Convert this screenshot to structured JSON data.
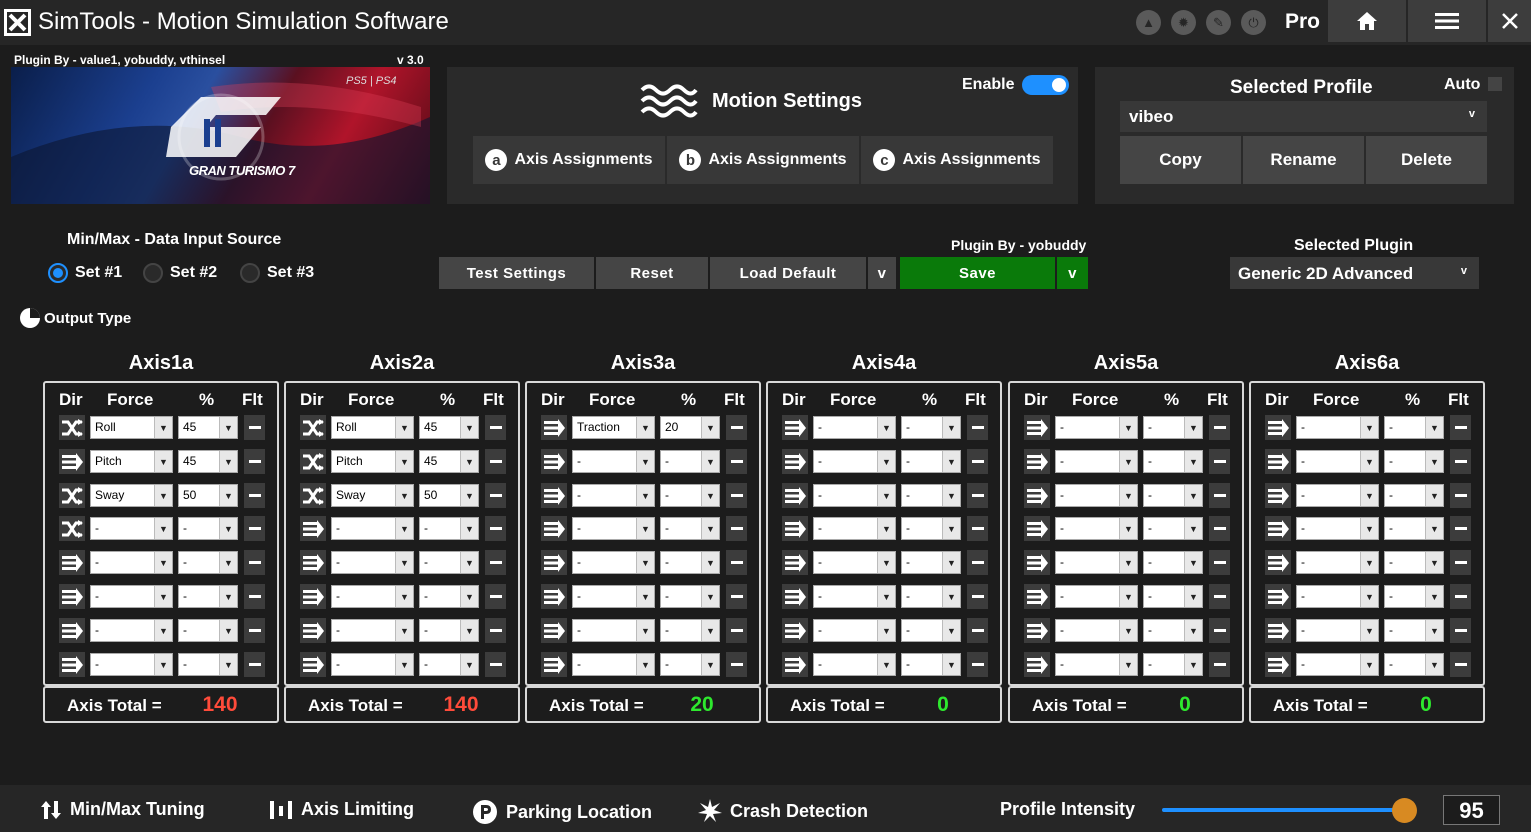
{
  "app": {
    "title": "SimTools - Motion Simulation Software",
    "edition": "Pro",
    "toolbar_icons": [
      "upload-icon",
      "gear-badge-icon",
      "edit-icon",
      "power-icon"
    ],
    "window_buttons": [
      "home-icon",
      "menu-icon",
      "close-icon"
    ]
  },
  "plugin_banner": {
    "plugin_by": "Plugin By - value1, yobuddy, vthinsel",
    "version": "v 3.0",
    "game_name": "GRAN TURISMO 7",
    "platform": "PS5 | PS4"
  },
  "motion_settings": {
    "title": "Motion Settings",
    "enable_label": "Enable",
    "enabled": true,
    "tabs": [
      {
        "letter": "a",
        "label": "Axis Assignments"
      },
      {
        "letter": "b",
        "label": "Axis Assignments"
      },
      {
        "letter": "c",
        "label": "Axis Assignments"
      }
    ]
  },
  "profile": {
    "title": "Selected Profile",
    "auto_label": "Auto",
    "auto_checked": false,
    "selected": "vibeo",
    "copy_label": "Copy",
    "rename_label": "Rename",
    "delete_label": "Delete"
  },
  "data_source": {
    "label": "Min/Max - Data Input Source",
    "options": [
      "Set #1",
      "Set #2",
      "Set #3"
    ],
    "selected_index": 0
  },
  "actions": {
    "test_label": "Test Settings",
    "reset_label": "Reset",
    "load_default_label": "Load Default",
    "dropdown_caret": "v",
    "save_label": "Save",
    "plugin_by": "Plugin By - yobuddy"
  },
  "selected_plugin": {
    "label": "Selected Plugin",
    "value": "Generic 2D Advanced"
  },
  "output_type_label": "Output Type",
  "axis_headers": {
    "dir": "Dir",
    "force": "Force",
    "pct": "%",
    "flt": "Flt"
  },
  "axis_total_label": "Axis Total =",
  "colors": {
    "accent": "#1e90ff",
    "save_green": "#0a7a0a",
    "total_red": "#ff4b3a",
    "total_green": "#2ee82e",
    "slider_knob": "#d88a22"
  },
  "axes": [
    {
      "name": "Axis1a",
      "total": "140",
      "total_status": "over",
      "rows": [
        {
          "dir": "reverse",
          "force": "Roll",
          "pct": "45"
        },
        {
          "dir": "normal",
          "force": "Pitch",
          "pct": "45"
        },
        {
          "dir": "reverse",
          "force": "Sway",
          "pct": "50"
        },
        {
          "dir": "reverse",
          "force": "-",
          "pct": "-"
        },
        {
          "dir": "normal",
          "force": "-",
          "pct": "-"
        },
        {
          "dir": "normal",
          "force": "-",
          "pct": "-"
        },
        {
          "dir": "normal",
          "force": "-",
          "pct": "-"
        },
        {
          "dir": "normal",
          "force": "-",
          "pct": "-"
        }
      ]
    },
    {
      "name": "Axis2a",
      "total": "140",
      "total_status": "over",
      "rows": [
        {
          "dir": "reverse",
          "force": "Roll",
          "pct": "45"
        },
        {
          "dir": "reverse",
          "force": "Pitch",
          "pct": "45"
        },
        {
          "dir": "reverse",
          "force": "Sway",
          "pct": "50"
        },
        {
          "dir": "normal",
          "force": "-",
          "pct": "-"
        },
        {
          "dir": "normal",
          "force": "-",
          "pct": "-"
        },
        {
          "dir": "normal",
          "force": "-",
          "pct": "-"
        },
        {
          "dir": "normal",
          "force": "-",
          "pct": "-"
        },
        {
          "dir": "normal",
          "force": "-",
          "pct": "-"
        }
      ]
    },
    {
      "name": "Axis3a",
      "total": "20",
      "total_status": "ok",
      "rows": [
        {
          "dir": "normal",
          "force": "Traction",
          "pct": "20"
        },
        {
          "dir": "normal",
          "force": "-",
          "pct": "-"
        },
        {
          "dir": "normal",
          "force": "-",
          "pct": "-"
        },
        {
          "dir": "normal",
          "force": "-",
          "pct": "-"
        },
        {
          "dir": "normal",
          "force": "-",
          "pct": "-"
        },
        {
          "dir": "normal",
          "force": "-",
          "pct": "-"
        },
        {
          "dir": "normal",
          "force": "-",
          "pct": "-"
        },
        {
          "dir": "normal",
          "force": "-",
          "pct": "-"
        }
      ]
    },
    {
      "name": "Axis4a",
      "total": "0",
      "total_status": "ok",
      "rows": [
        {
          "dir": "normal",
          "force": "-",
          "pct": "-"
        },
        {
          "dir": "normal",
          "force": "-",
          "pct": "-"
        },
        {
          "dir": "normal",
          "force": "-",
          "pct": "-"
        },
        {
          "dir": "normal",
          "force": "-",
          "pct": "-"
        },
        {
          "dir": "normal",
          "force": "-",
          "pct": "-"
        },
        {
          "dir": "normal",
          "force": "-",
          "pct": "-"
        },
        {
          "dir": "normal",
          "force": "-",
          "pct": "-"
        },
        {
          "dir": "normal",
          "force": "-",
          "pct": "-"
        }
      ]
    },
    {
      "name": "Axis5a",
      "total": "0",
      "total_status": "ok",
      "rows": [
        {
          "dir": "normal",
          "force": "-",
          "pct": "-"
        },
        {
          "dir": "normal",
          "force": "-",
          "pct": "-"
        },
        {
          "dir": "normal",
          "force": "-",
          "pct": "-"
        },
        {
          "dir": "normal",
          "force": "-",
          "pct": "-"
        },
        {
          "dir": "normal",
          "force": "-",
          "pct": "-"
        },
        {
          "dir": "normal",
          "force": "-",
          "pct": "-"
        },
        {
          "dir": "normal",
          "force": "-",
          "pct": "-"
        },
        {
          "dir": "normal",
          "force": "-",
          "pct": "-"
        }
      ]
    },
    {
      "name": "Axis6a",
      "total": "0",
      "total_status": "ok",
      "rows": [
        {
          "dir": "normal",
          "force": "-",
          "pct": "-"
        },
        {
          "dir": "normal",
          "force": "-",
          "pct": "-"
        },
        {
          "dir": "normal",
          "force": "-",
          "pct": "-"
        },
        {
          "dir": "normal",
          "force": "-",
          "pct": "-"
        },
        {
          "dir": "normal",
          "force": "-",
          "pct": "-"
        },
        {
          "dir": "normal",
          "force": "-",
          "pct": "-"
        },
        {
          "dir": "normal",
          "force": "-",
          "pct": "-"
        },
        {
          "dir": "normal",
          "force": "-",
          "pct": "-"
        }
      ]
    }
  ],
  "bottom_bar": {
    "minmax_tuning": "Min/Max Tuning",
    "axis_limiting": "Axis Limiting",
    "parking_location": "Parking Location",
    "crash_detection": "Crash Detection",
    "profile_intensity_label": "Profile Intensity",
    "profile_intensity_value": 95
  }
}
